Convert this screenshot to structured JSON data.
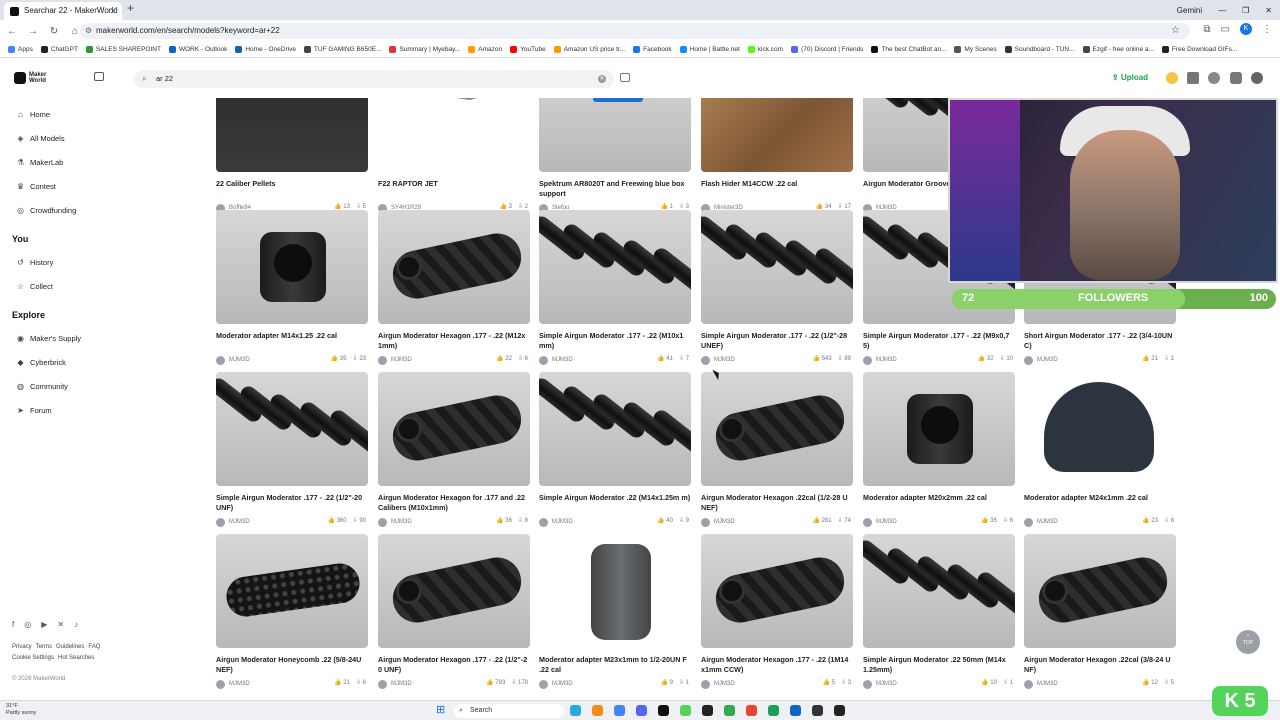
{
  "browser": {
    "tab_title": "Searchar 22 - MakerWorld",
    "profile_label": "Gemini",
    "url": "makerworld.com/en/search/models?keyword=ar+22",
    "bookmarks": [
      "Apps",
      "ChatGPT",
      "SALES SHAREPOINT",
      "WORK - Outlook",
      "Home - OneDrive",
      "TUF GAMING B650E...",
      "Summary | Myebay...",
      "Amazon",
      "YouTube",
      "Amazon US price tr...",
      "Facebook",
      "Home | Battle.net",
      "kick.com",
      "(70) Discord | Friends",
      "The best ChatBot an...",
      "My Scenes",
      "Soundboard - TUN...",
      "Ezgif - free online a...",
      "Free Download GIFs..."
    ],
    "bookmark_colors": [
      "#4285f4",
      "#222",
      "#2b9a3e",
      "#0a66c2",
      "#0a66c2",
      "#444",
      "#e53238",
      "#ff9900",
      "#ff0000",
      "#ff9900",
      "#1877f2",
      "#148eff",
      "#53fc18",
      "#5865f2",
      "#111",
      "#555",
      "#333",
      "#444",
      "#222"
    ]
  },
  "sidebar": {
    "logo_line1": "Maker",
    "logo_line2": "World",
    "main": [
      {
        "label": "Home",
        "icon": "⌂"
      },
      {
        "label": "All Models",
        "icon": "◈"
      },
      {
        "label": "MakerLab",
        "icon": "⚗"
      },
      {
        "label": "Contest",
        "icon": "♛"
      },
      {
        "label": "Crowdfunding",
        "icon": "◎"
      }
    ],
    "you_heading": "You",
    "you": [
      {
        "label": "History",
        "icon": "↺"
      },
      {
        "label": "Collect",
        "icon": "☆"
      }
    ],
    "explore_heading": "Explore",
    "explore": [
      {
        "label": "Maker's Supply",
        "icon": "◉"
      },
      {
        "label": "Cyberbrick",
        "icon": "◆"
      },
      {
        "label": "Community",
        "icon": "◍"
      },
      {
        "label": "Forum",
        "icon": "➤"
      }
    ],
    "footer_links_1": [
      "Privacy",
      "Terms",
      "Guidelines",
      "FAQ"
    ],
    "footer_links_2": [
      "Cookie Settings",
      "Hot Searches"
    ],
    "copyright": "© 2026 MakerWorld"
  },
  "topbar": {
    "search_value": "ar 22",
    "upload_label": "Upload",
    "notification_count": "2"
  },
  "cards": [
    {
      "title": "22 Caliber Pellets",
      "author": "Boffle94",
      "likes": "13",
      "downloads": "5",
      "thumb": "green"
    },
    {
      "title": "F22 RAPTOR JET",
      "author": "SY4H1R29",
      "likes": "3",
      "downloads": "2",
      "thumb": "jet"
    },
    {
      "title": "Spektrum AR8020T and Freewing blue box support",
      "author": "Stefou",
      "likes": "1",
      "downloads": "3",
      "thumb": "blue"
    },
    {
      "title": "Flash Hider M14CCW .22 cal",
      "author": "Minister3D",
      "likes": "34",
      "downloads": "17",
      "thumb": "wood"
    },
    {
      "title": "Airgun Moderator Groove 0 UNF)",
      "author": "MJM3D",
      "likes": "",
      "downloads": "",
      "thumb": "tubes"
    },
    {
      "title": "Moderator adapter M14x1.25 .22 cal",
      "author": "MJM3D",
      "likes": "35",
      "downloads": "23",
      "thumb": "adapter"
    },
    {
      "title": "Airgun Moderator Hexagon .177 - .22 (M12x 1mm)",
      "author": "MJM3D",
      "likes": "22",
      "downloads": "6",
      "thumb": "hex"
    },
    {
      "title": "Simple Airgun Moderator .177 - .22 (M10x1 mm)",
      "author": "MJM3D",
      "likes": "41",
      "downloads": "7",
      "thumb": "tubes"
    },
    {
      "title": "Simple Airgun Moderator .177 - .22 (1/2\"-28 UNEF)",
      "author": "MJM3D",
      "likes": "543",
      "downloads": "89",
      "thumb": "tubes"
    },
    {
      "title": "Simple Airgun Moderator .177 - .22 (M9x0,7 5)",
      "author": "MJM3D",
      "likes": "32",
      "downloads": "10",
      "thumb": "tubes"
    },
    {
      "title": "Short Airgun Moderator .177 - .22 (3/4-10UN C)",
      "author": "MJM3D",
      "likes": "21",
      "downloads": "1",
      "thumb": "tubes"
    },
    {
      "title": "Simple Airgun Moderator .177 - .22 (1/2\"-20 UNF)",
      "author": "MJM3D",
      "likes": "360",
      "downloads": "90",
      "thumb": "tubes"
    },
    {
      "title": "Airgun Moderator Hexagon for .177 and .22 Calibers (M10x1mm)",
      "author": "MJM3D",
      "likes": "36",
      "downloads": "8",
      "thumb": "hex"
    },
    {
      "title": "Simple Airgun Moderator .22 (M14x1.25m m)",
      "author": "MJM3D",
      "likes": "40",
      "downloads": "9",
      "thumb": "tubes"
    },
    {
      "title": "Airgun Moderator Hexagon .22cal (1/2-28 U NEF)",
      "author": "MJM3D",
      "likes": "281",
      "downloads": "74",
      "thumb": "hex"
    },
    {
      "title": "Moderator adapter M20x2mm .22 cal",
      "author": "MJM3D",
      "likes": "35",
      "downloads": "6",
      "thumb": "adapter"
    },
    {
      "title": "Moderator adapter M24x1mm .22 cal",
      "author": "MJM3D",
      "likes": "23",
      "downloads": "8",
      "thumb": "hat"
    },
    {
      "title": "Airgun Moderator Honeycomb .22 (5/8-24U NEF)",
      "author": "MJM3D",
      "likes": "21",
      "downloads": "6",
      "thumb": "honey"
    },
    {
      "title": "Airgun Moderator Hexagon .177 - .22 (1/2\"-2 0 UNF)",
      "author": "MJM3D",
      "likes": "783",
      "downloads": "178",
      "thumb": "hex"
    },
    {
      "title": "Moderator adapter M23x1mm to 1/2-20UN F .22 cal",
      "author": "MJM3D",
      "likes": "9",
      "downloads": "1",
      "thumb": "adapterw"
    },
    {
      "title": "Airgun Moderator Hexagon .177 - .22 (1M14 x1mm CCW)",
      "author": "MJM3D",
      "likes": "5",
      "downloads": "3",
      "thumb": "hex"
    },
    {
      "title": "Simple Airgun Moderator .22 50mm (M14x 1.25mm)",
      "author": "MJM3D",
      "likes": "10",
      "downloads": "1",
      "thumb": "tubes"
    },
    {
      "title": "Airgun Moderator Hexagon .22cal (3/8-24 U NF)",
      "author": "MJM3D",
      "likes": "12",
      "downloads": "5",
      "thumb": "hex"
    }
  ],
  "overlay": {
    "followers_label": "FOLLOWERS",
    "followers_current": "72",
    "followers_goal": "100",
    "followers_progress": 0.72,
    "to_top_label": "TOP",
    "k_badge": "K 5"
  },
  "taskbar": {
    "temp": "31°F",
    "weather": "Partly sunny",
    "search_label": "Search",
    "app_colors": [
      "#2aa9e0",
      "#f28b1a",
      "#4285f4",
      "#5865f2",
      "#111",
      "#53d35a",
      "#222",
      "#34a853",
      "#ea4335",
      "#1f9e57",
      "#0a66c2",
      "#333",
      "#222"
    ]
  }
}
